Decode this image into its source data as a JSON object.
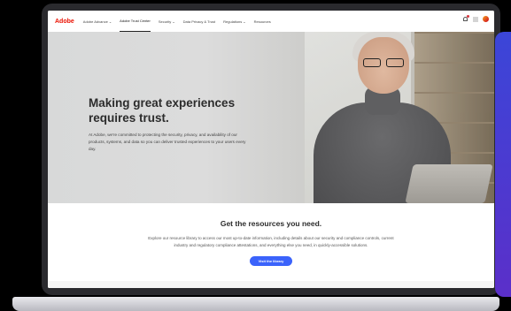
{
  "nav": {
    "logo": "Adobe",
    "items": [
      {
        "label": "Adobe Advance",
        "caret": true,
        "active": false
      },
      {
        "label": "Adobe Trust Center",
        "caret": false,
        "active": true
      },
      {
        "label": "Security",
        "caret": true,
        "active": false
      },
      {
        "label": "Data Privacy & Trust",
        "caret": false,
        "active": false
      },
      {
        "label": "Regulations",
        "caret": true,
        "active": false
      },
      {
        "label": "Resources",
        "caret": false,
        "active": false
      }
    ],
    "caret_glyph": "⌄",
    "icons": [
      "bell-icon",
      "apps-grid-icon",
      "profile-avatar"
    ]
  },
  "hero": {
    "title": "Making great experiences requires trust.",
    "body": "At Adobe, we're committed to protecting the security, privacy, and availability of our products, systems, and data so you can deliver trusted experiences to your users every day."
  },
  "resources": {
    "title": "Get the resources you need.",
    "body": "Explore our resource library to access our most up-to-date information, including details about our security and compliance controls, current industry and regulatory compliance attestations, and everything else you need, in quickly-accessible solutions.",
    "button": "Visit the library"
  },
  "colors": {
    "brand": "#eb1000",
    "button": "#3b63fb",
    "accent_frame": "#3b46d8"
  }
}
